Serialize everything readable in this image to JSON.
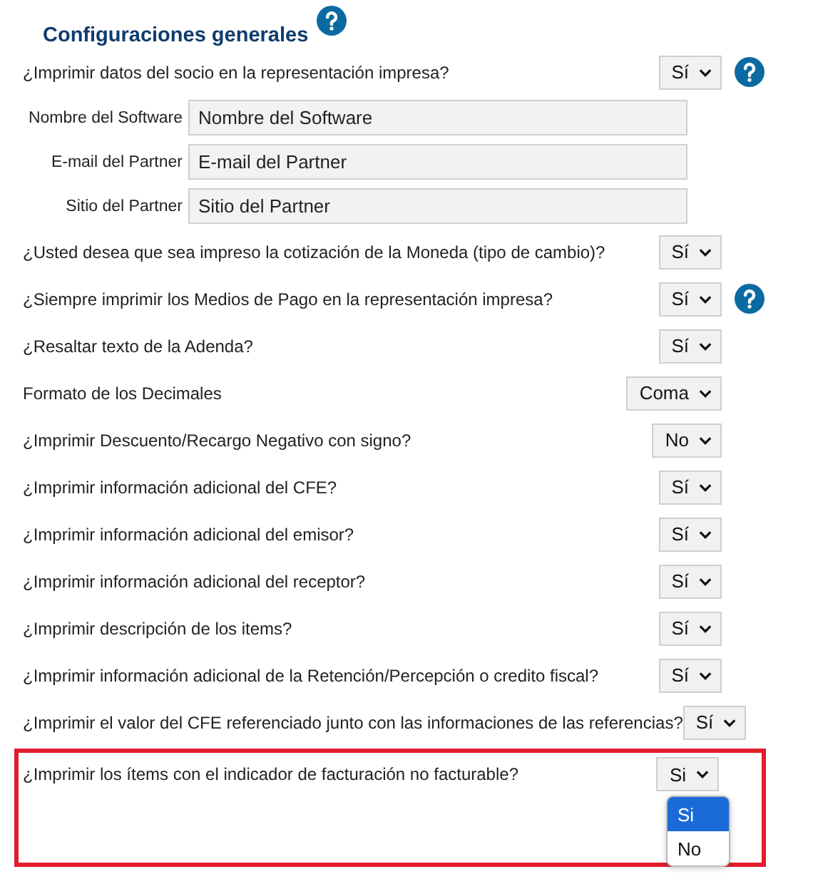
{
  "section": {
    "title": "Configuraciones generales",
    "help": true
  },
  "rows": [
    {
      "kind": "select",
      "label": "¿Imprimir datos del socio en la representación impresa?",
      "value": "Sí",
      "help": true
    },
    {
      "kind": "text_field",
      "label": "Nombre del Software",
      "value": "Nombre del Software"
    },
    {
      "kind": "text_field",
      "label": "E-mail del Partner",
      "value": "E-mail del Partner"
    },
    {
      "kind": "text_field",
      "label": "Sitio del Partner",
      "value": "Sitio del Partner"
    },
    {
      "kind": "select",
      "label": "¿Usted desea que sea impreso la cotización de la Moneda (tipo de cambio)?",
      "value": "Sí",
      "help": false
    },
    {
      "kind": "select",
      "label": "¿Siempre imprimir los Medios de Pago en la representación impresa?",
      "value": "Sí",
      "help": true
    },
    {
      "kind": "select",
      "label": "¿Resaltar texto de la Adenda?",
      "value": "Sí",
      "help": false
    },
    {
      "kind": "select",
      "label": "Formato de los Decimales",
      "value": "Coma",
      "help": false
    },
    {
      "kind": "select",
      "label": "¿Imprimir Descuento/Recargo Negativo con signo?",
      "value": "No",
      "help": false
    },
    {
      "kind": "select",
      "label": "¿Imprimir información adicional del CFE?",
      "value": "Sí",
      "help": false
    },
    {
      "kind": "select",
      "label": "¿Imprimir información adicional del emisor?",
      "value": "Sí",
      "help": false
    },
    {
      "kind": "select",
      "label": "¿Imprimir información adicional del receptor?",
      "value": "Sí",
      "help": false
    },
    {
      "kind": "select",
      "label": "¿Imprimir descripción de los items?",
      "value": "Sí",
      "help": false
    },
    {
      "kind": "select",
      "label": "¿Imprimir información adicional de la Retención/Percepción o credito fiscal?",
      "value": "Sí",
      "help": false
    },
    {
      "kind": "select",
      "label": "¿Imprimir el valor del CFE referenciado junto con las informaciones de las referencias?",
      "value": "Sí",
      "help": false
    },
    {
      "kind": "select",
      "label": "¿Imprimir los ítems con el indicador de facturación no facturable?",
      "value": "Si",
      "help": false,
      "highlighted": true,
      "expanded": true,
      "options": [
        {
          "label": "Si",
          "selected": true
        },
        {
          "label": "No",
          "selected": false
        }
      ]
    }
  ]
}
